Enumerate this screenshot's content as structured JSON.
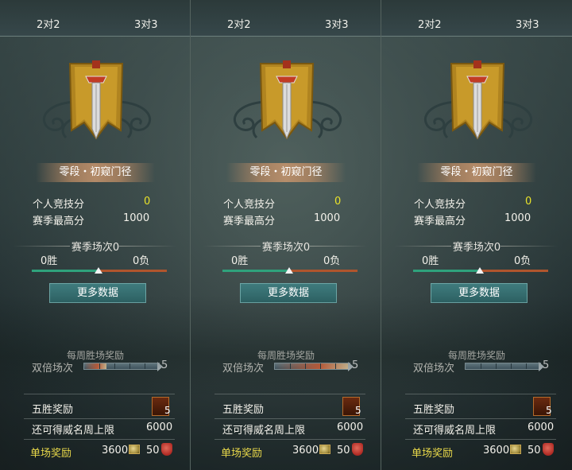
{
  "panels": [
    {
      "tabs": [
        "2对2",
        "3对3"
      ],
      "rank_title": "零段・初窥门径",
      "personal_score_label": "个人竞技分",
      "personal_score": "0",
      "season_high_label": "赛季最高分",
      "season_high": "1000",
      "season_matches": "赛季场次0",
      "wins": "0胜",
      "losses": "0负",
      "more_data_button": "更多数据",
      "weekly_reward_title": "每周胜场奖励",
      "double_label": "双倍场次",
      "double_count": "5",
      "double_fill_percent": 30,
      "five_win_label": "五胜奖励",
      "five_win_count": "5",
      "weekly_cap_label": "还可得威名周上限",
      "weekly_cap_value": "6000",
      "single_reward_label": "单场奖励",
      "single_reward_coin": "3600",
      "single_reward_shield": "50"
    },
    {
      "tabs": [
        "2对2",
        "3对3"
      ],
      "rank_title": "零段・初窥门径",
      "personal_score_label": "个人竞技分",
      "personal_score": "0",
      "season_high_label": "赛季最高分",
      "season_high": "1000",
      "season_matches": "赛季场次0",
      "wins": "0胜",
      "losses": "0负",
      "more_data_button": "更多数据",
      "weekly_reward_title": "每周胜场奖励",
      "double_label": "双倍场次",
      "double_count": "5",
      "double_fill_percent": 100,
      "five_win_label": "五胜奖励",
      "five_win_count": "5",
      "weekly_cap_label": "还可得威名周上限",
      "weekly_cap_value": "6000",
      "single_reward_label": "单场奖励",
      "single_reward_coin": "3600",
      "single_reward_shield": "50"
    },
    {
      "tabs": [
        "2对2",
        "3对3"
      ],
      "rank_title": "零段・初窥门径",
      "personal_score_label": "个人竞技分",
      "personal_score": "0",
      "season_high_label": "赛季最高分",
      "season_high": "1000",
      "season_matches": "赛季场次0",
      "wins": "0胜",
      "losses": "0负",
      "more_data_button": "更多数据",
      "weekly_reward_title": "每周胜场奖励",
      "double_label": "双倍场次",
      "double_count": "5",
      "double_fill_percent": 0,
      "five_win_label": "五胜奖励",
      "five_win_count": "5",
      "weekly_cap_label": "还可得威名周上限",
      "weekly_cap_value": "6000",
      "single_reward_label": "单场奖励",
      "single_reward_coin": "3600",
      "single_reward_shield": "50"
    }
  ],
  "colors": {
    "accent_yellow": "#e8e22a",
    "win_green": "#2fa27c",
    "loss_orange": "#b0552d",
    "button_teal": "#3f7b7d"
  },
  "icons": {
    "emblem": "sword-banner-icon",
    "chest": "treasure-chest-icon",
    "coin": "coin-icon",
    "shield": "shield-icon"
  }
}
